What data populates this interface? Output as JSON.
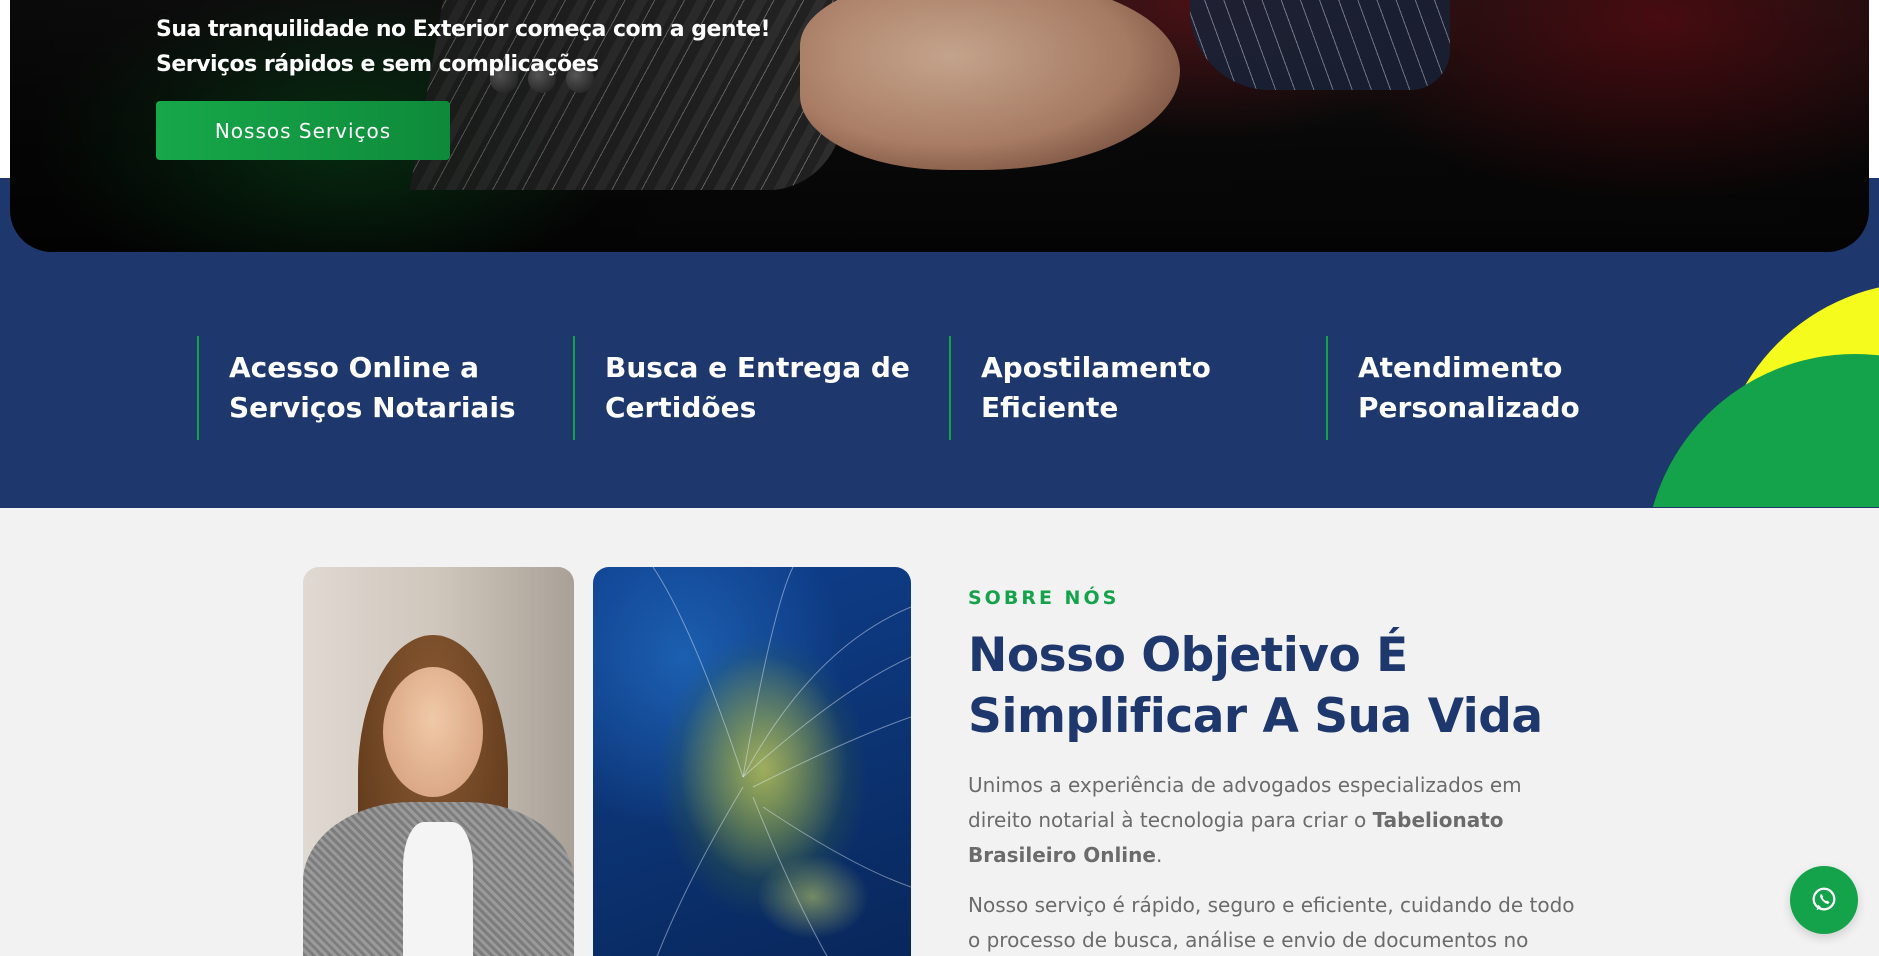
{
  "hero": {
    "tagline": "Sua tranquilidade no Exterior começa com a gente! Serviços rápidos e sem complicações",
    "cta_label": "Nossos Serviços"
  },
  "features": [
    {
      "label": "Acesso Online a Serviços Notariais"
    },
    {
      "label": "Busca e Entrega de Certidões"
    },
    {
      "label": "Apostilamento Eficiente"
    },
    {
      "label": "Atendimento Personalizado"
    }
  ],
  "about": {
    "eyebrow": "SOBRE NÓS",
    "title": "Nosso Objetivo É Simplificar A Sua Vida",
    "p1_before": "Unimos a experiência de advogados especializados em direito notarial à tecnologia para criar o ",
    "p1_bold": "Tabelionato Brasileiro Online",
    "p1_after": ".",
    "p2": "Nosso serviço é rápido, seguro e eficiente, cuidando de todo o processo de busca, análise e envio de documentos no"
  },
  "colors": {
    "navy": "#1e376d",
    "green": "#14a34a",
    "yellow": "#f5fb1c"
  },
  "icons": {
    "floating_button": "whatsapp-icon"
  }
}
